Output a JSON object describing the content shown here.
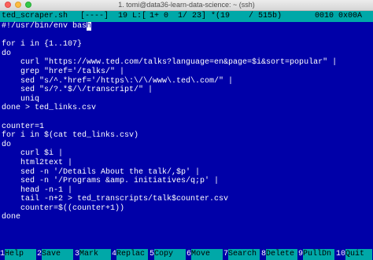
{
  "window": {
    "title": "1. tomi@data36-learn-data-science: ~ (ssh)"
  },
  "status": {
    "filename": "ted_scraper.sh",
    "flags": "[----]",
    "col": "19 L:[",
    "lines": "1+ 0",
    "lineinfo": "1/ 23] *(19",
    "bytes": "/ 515b)",
    "code": "0010 0x00A"
  },
  "code_lines": [
    "#!/usr/bin/env bash",
    "",
    "for i in {1..107}",
    "do",
    "    curl \"https://www.ted.com/talks?language=en&page=$i&sort=popular\" |",
    "    grep \"href='/talks/\" |",
    "    sed \"s/^.*href='/https\\:\\/\\/www\\.ted\\.com/\" |",
    "    sed \"s/?.*$/\\/transcript/\" |",
    "    uniq",
    "done > ted_links.csv",
    "",
    "counter=1",
    "for i in $(cat ted_links.csv)",
    "do",
    "    curl $i |",
    "    html2text |",
    "    sed -n '/Details About the talk/,$p' |",
    "    sed -n '/Programs &amp. initiatives/q;p' |",
    "    head -n-1 |",
    "    tail -n+2 > ted_transcripts/talk$counter.csv",
    "    counter=$((counter+1))",
    "done"
  ],
  "first_line_parts": {
    "before_cursor": "#!/usr/bin/env bas",
    "cursor_char": "h"
  },
  "keys": [
    {
      "num": "1",
      "label": "Help"
    },
    {
      "num": "2",
      "label": "Save"
    },
    {
      "num": "3",
      "label": "Mark"
    },
    {
      "num": "4",
      "label": "Replac"
    },
    {
      "num": "5",
      "label": "Copy"
    },
    {
      "num": "6",
      "label": "Move"
    },
    {
      "num": "7",
      "label": "Search"
    },
    {
      "num": "8",
      "label": "Delete"
    },
    {
      "num": "9",
      "label": "PullDn"
    },
    {
      "num": "10",
      "label": "Quit"
    }
  ],
  "colors": {
    "background": "#0000a8",
    "bar": "#00a8a8",
    "text": "#ffffff"
  }
}
